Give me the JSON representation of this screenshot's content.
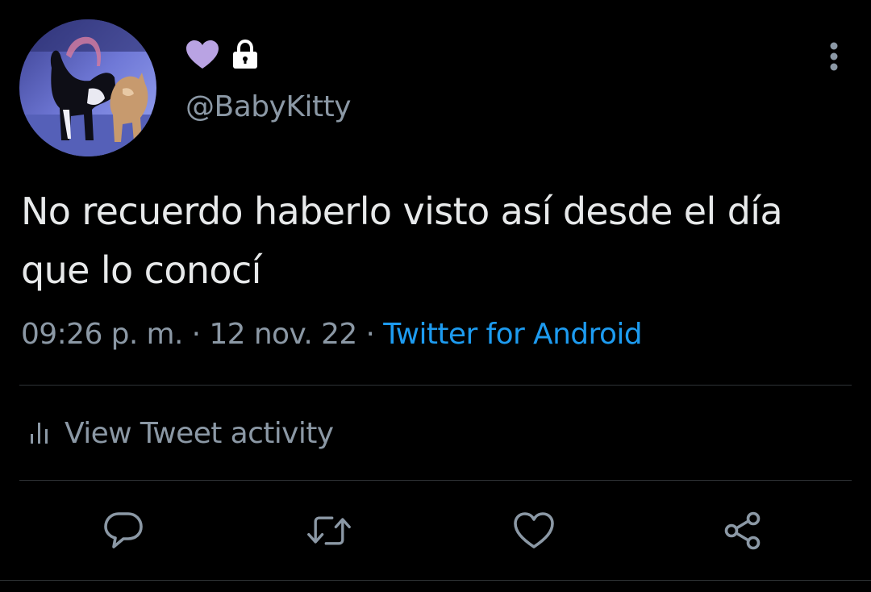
{
  "user": {
    "handle": "@BabyKitty",
    "name_icons": [
      "purple-heart-icon",
      "lock-icon"
    ]
  },
  "tweet": {
    "text": "No recuerdo haberlo visto así desde el día que lo conocí",
    "time": "09:26 p. m.",
    "separator": " · ",
    "date": "12 nov. 22",
    "source": "Twitter for Android"
  },
  "activity": {
    "label": "View Tweet activity",
    "icon": "bar-chart-icon"
  },
  "actions": [
    "reply-icon",
    "retweet-icon",
    "like-icon",
    "share-icon"
  ],
  "colors": {
    "background": "#000000",
    "text": "#e7e9ea",
    "muted": "#8b98a5",
    "link": "#1d9bf0",
    "heart": "#b9a3e3",
    "divider": "#2f3336"
  }
}
